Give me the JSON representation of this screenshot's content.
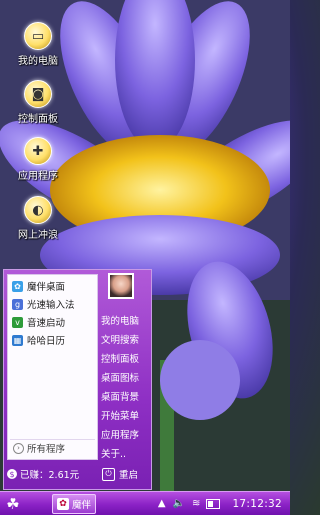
{
  "desktop": {
    "icons": [
      {
        "label": "我的电脑",
        "icon": "computer-icon",
        "glyph": "▭"
      },
      {
        "label": "控制面板",
        "icon": "control-panel-icon",
        "glyph": "◙"
      },
      {
        "label": "应用程序",
        "icon": "applications-icon",
        "glyph": "✚"
      },
      {
        "label": "网上冲浪",
        "icon": "browser-icon",
        "glyph": "◐"
      }
    ]
  },
  "start_menu": {
    "apps": [
      {
        "label": "魔伴桌面",
        "icon": "desktop-app-icon",
        "glyph": "✿",
        "color": "#3aa0e8"
      },
      {
        "label": "光速输入法",
        "icon": "input-method-icon",
        "glyph": "g",
        "color": "#4a6fd8"
      },
      {
        "label": "音速启动",
        "icon": "quick-launch-icon",
        "glyph": "v",
        "color": "#2e9b3a"
      },
      {
        "label": "哈哈日历",
        "icon": "calendar-icon",
        "glyph": "▦",
        "color": "#2f7ad0"
      }
    ],
    "all_programs": "所有程序",
    "right_items": [
      "我的电脑",
      "文明搜索",
      "控制面板",
      "桌面图标",
      "桌面背景",
      "开始菜单",
      "应用程序",
      "关于.."
    ],
    "earned": "已赚：2.61元",
    "restart": "重启"
  },
  "taskbar": {
    "task_label": "魔伴",
    "clock": "17:12:32",
    "battery_level": 0.45
  },
  "colors": {
    "accent": "#8e2fc4",
    "taskbar": "#8b22c6"
  }
}
